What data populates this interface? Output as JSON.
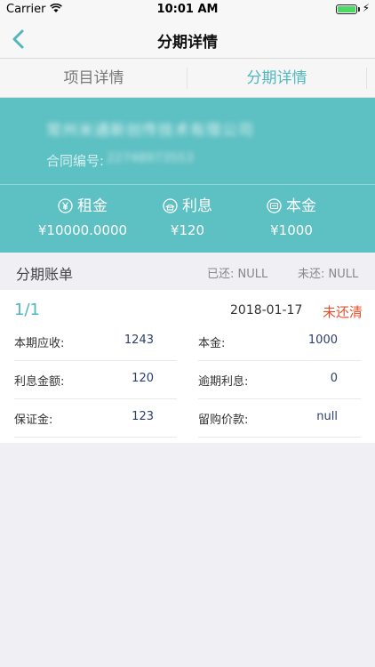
{
  "status_bar": {
    "carrier": "Carrier",
    "time": "10:01 AM"
  },
  "nav": {
    "title": "分期详情"
  },
  "tabs": [
    {
      "label": "项目详情"
    },
    {
      "label": "分期详情"
    }
  ],
  "hero": {
    "company_name": "常州米通新创传技术有限公司",
    "contract_label": "合同编号:",
    "contract_number": "22748973553",
    "stats": [
      {
        "label": "租金",
        "value": "¥10000.0000",
        "icon": "yen-icon"
      },
      {
        "label": "利息",
        "value": "¥120",
        "icon": "interest-icon"
      },
      {
        "label": "本金",
        "value": "¥1000",
        "icon": "principal-icon"
      }
    ]
  },
  "bill": {
    "title": "分期账单",
    "paid": "已还: NULL",
    "unpaid": "未还: NULL"
  },
  "installment": {
    "period": "1/1",
    "date": "2018-01-17",
    "status": "未还清",
    "fields": [
      {
        "label": "本期应收:",
        "value": "1243"
      },
      {
        "label": "本金:",
        "value": "1000"
      },
      {
        "label": "利息金额:",
        "value": "120"
      },
      {
        "label": "逾期利息:",
        "value": "0"
      },
      {
        "label": "保证金:",
        "value": "123"
      },
      {
        "label": "留购价款:",
        "value": "null"
      }
    ]
  },
  "colors": {
    "accent": "#5dc0c3",
    "tab_active": "#4fb7bd",
    "status_red": "#e2502f"
  }
}
